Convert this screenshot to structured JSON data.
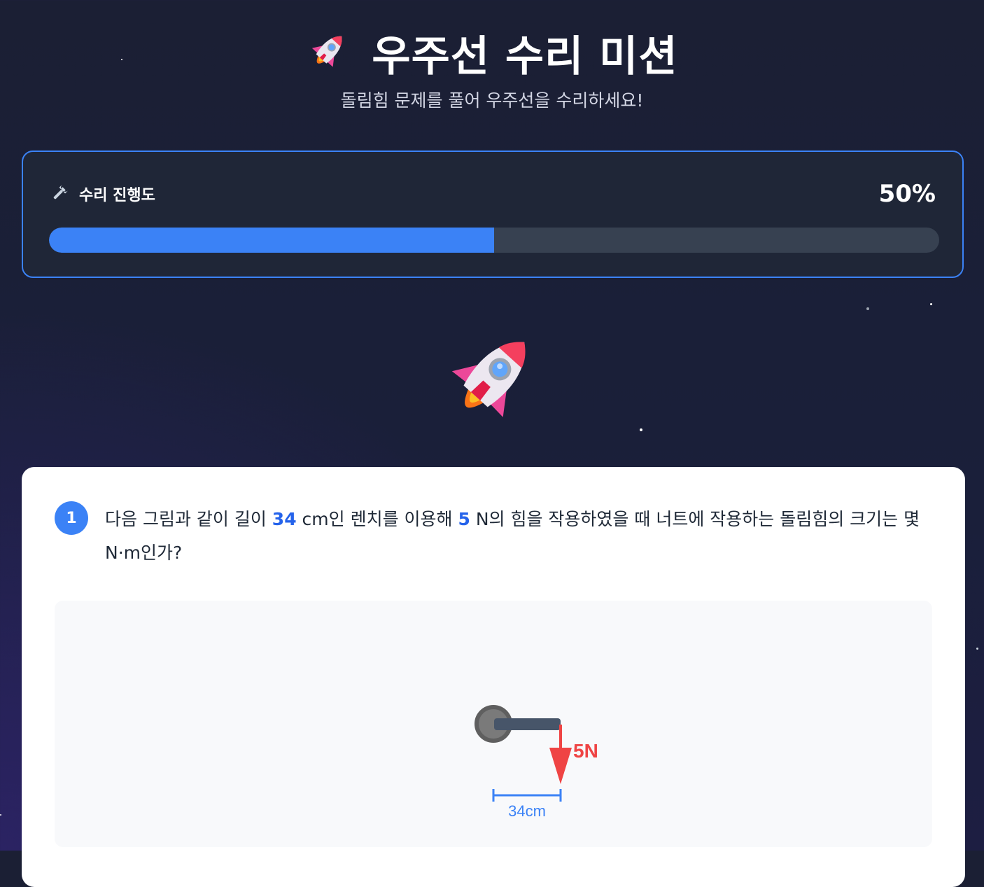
{
  "header": {
    "title": "우주선 수리 미션",
    "subtitle": "돌림힘 문제를 풀어 우주선을 수리하세요!",
    "title_icon": "rocket-icon"
  },
  "progress": {
    "label": "수리 진행도",
    "label_icon": "wrench-icon",
    "percent_text": "50%",
    "value": 0.5,
    "accent_color": "#3b82f6"
  },
  "question": {
    "number": "1",
    "text_before_length": "다음 그림과 같이 길이 ",
    "length_value": "34",
    "text_after_length": " cm인 렌치를 이용해 ",
    "force_value": "5",
    "text_after_force": " N의 힘을 작용하였을 때 너트에 작용하는 돌림힘의 크기는 몇 N·m인가?",
    "figure": {
      "force_label": "5N",
      "length_label": "34cm",
      "force_color": "#ef4444",
      "length_color": "#3b82f6"
    }
  }
}
